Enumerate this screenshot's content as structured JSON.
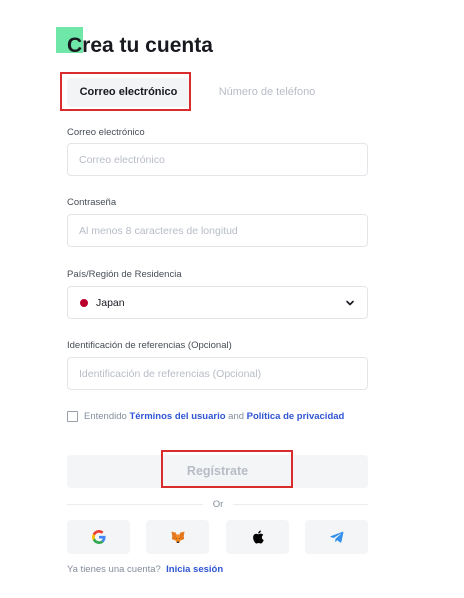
{
  "header": {
    "title": "Crea tu cuenta"
  },
  "tabs": {
    "email": "Correo electrónico",
    "phone": "Número de teléfono"
  },
  "form": {
    "email_label": "Correo electrónico",
    "email_placeholder": "Correo electrónico",
    "password_label": "Contraseña",
    "password_placeholder": "Al menos 8 caracteres de longitud",
    "country_label": "País/Región de Residencia",
    "country_value": "Japan",
    "referral_label": "Identificación de referencias (Opcional)",
    "referral_placeholder": "Identificación de referencias (Opcional)"
  },
  "terms": {
    "prefix": "Entendido",
    "terms_link": "Términos del usuario",
    "and": "and",
    "privacy_link": "Política de privacidad"
  },
  "register_button": "Regístrate",
  "divider": "Or",
  "social": [
    {
      "name": "google-icon"
    },
    {
      "name": "metamask-icon"
    },
    {
      "name": "apple-icon"
    },
    {
      "name": "telegram-icon"
    }
  ],
  "footer": {
    "question": "Ya tienes una cuenta?",
    "login_link": "Inicia sesión"
  },
  "colors": {
    "accent_link": "#2f55d4",
    "logo": "#6ee7a8",
    "highlight": "#d92d2d"
  }
}
